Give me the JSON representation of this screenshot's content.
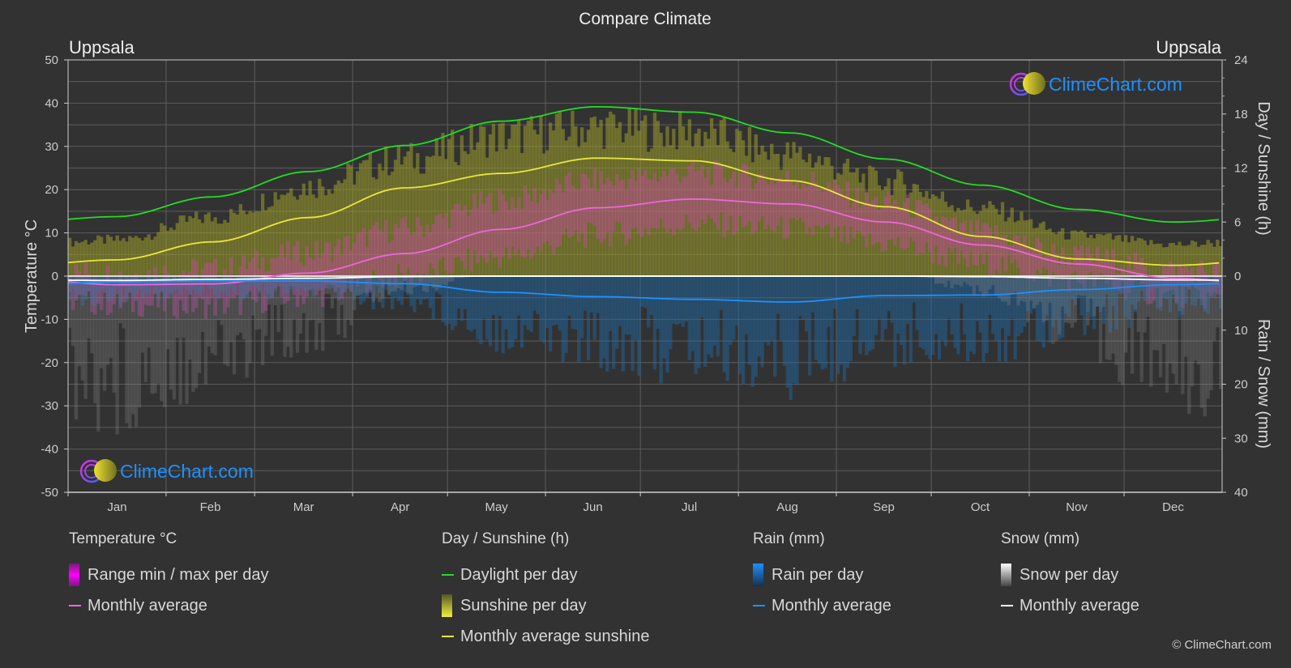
{
  "title": "Compare Climate",
  "location_left": "Uppsala",
  "location_right": "Uppsala",
  "watermark": "ClimeChart.com",
  "copyright": "© ClimeChart.com",
  "chart_data": {
    "type": "area",
    "title": "Compare Climate",
    "categories": [
      "Jan",
      "Feb",
      "Mar",
      "Apr",
      "May",
      "Jun",
      "Jul",
      "Aug",
      "Sep",
      "Oct",
      "Nov",
      "Dec"
    ],
    "left_axis": {
      "label": "Temperature °C",
      "range": [
        -50,
        50
      ],
      "ticks": [
        50,
        40,
        30,
        20,
        10,
        0,
        -10,
        -20,
        -30,
        -40,
        -50
      ]
    },
    "right_axis_top": {
      "label": "Day / Sunshine (h)",
      "range": [
        0,
        24
      ],
      "ticks": [
        24,
        18,
        12,
        6,
        0
      ]
    },
    "right_axis_bottom": {
      "label": "Rain / Snow (mm)",
      "range": [
        0,
        40
      ],
      "ticks": [
        0,
        10,
        20,
        30,
        40
      ]
    },
    "grid": true,
    "series": [
      {
        "name": "Daylight per day",
        "axis": "hours",
        "color": "#22dd22",
        "values": [
          6.6,
          8.8,
          11.6,
          14.5,
          17.2,
          18.8,
          18.2,
          15.9,
          13.0,
          10.1,
          7.4,
          6.0
        ]
      },
      {
        "name": "Monthly average sunshine",
        "axis": "hours",
        "color": "#e8e83a",
        "values": [
          1.8,
          3.8,
          6.5,
          9.8,
          11.4,
          13.1,
          12.8,
          10.6,
          7.7,
          4.4,
          1.9,
          1.2
        ]
      },
      {
        "name": "Temperature monthly average",
        "axis": "temperature",
        "color": "#ee66dd",
        "values": [
          -2.0,
          -1.8,
          0.7,
          5.2,
          10.8,
          15.8,
          17.8,
          16.7,
          12.5,
          7.2,
          2.8,
          -0.5
        ]
      },
      {
        "name": "Rain monthly average",
        "axis": "precip",
        "color": "#1e90ff",
        "values": [
          1.1,
          0.9,
          0.9,
          1.4,
          3.0,
          3.8,
          4.3,
          4.8,
          3.6,
          3.5,
          2.5,
          1.6
        ]
      },
      {
        "name": "Snow monthly average",
        "axis": "precip",
        "color": "#ffffff",
        "values": [
          0.8,
          0.6,
          0.4,
          0.1,
          0.0,
          0.0,
          0.0,
          0.0,
          0.0,
          0.1,
          0.4,
          0.7
        ]
      }
    ],
    "daily_ranges": {
      "temp_max_monthly": [
        0.5,
        1.5,
        5.5,
        11.0,
        17.5,
        22.0,
        24.0,
        22.5,
        17.0,
        10.0,
        4.5,
        1.5
      ],
      "temp_min_monthly": [
        -6.5,
        -7.0,
        -4.5,
        0.0,
        4.5,
        9.5,
        12.0,
        11.0,
        7.5,
        3.0,
        -1.0,
        -4.5
      ],
      "sunshine_max_monthly": [
        4.0,
        6.5,
        10.0,
        13.0,
        15.5,
        16.5,
        16.0,
        13.5,
        10.5,
        7.5,
        4.5,
        3.5
      ]
    }
  },
  "legend": {
    "temperature": {
      "title": "Temperature °C",
      "range_label": "Range min / max per day",
      "avg_label": "Monthly average"
    },
    "sunshine": {
      "title": "Day / Sunshine (h)",
      "daylight_label": "Daylight per day",
      "sunshine_label": "Sunshine per day",
      "avg_label": "Monthly average sunshine"
    },
    "rain": {
      "title": "Rain (mm)",
      "per_day_label": "Rain per day",
      "avg_label": "Monthly average"
    },
    "snow": {
      "title": "Snow (mm)",
      "per_day_label": "Snow per day",
      "avg_label": "Monthly average"
    }
  },
  "colors": {
    "background": "#323232",
    "grid": "#5a5a5a",
    "temp_range": "#e000e0",
    "sunshine": "#e8e83a",
    "daylight": "#22dd22",
    "rain": "#1e90ff",
    "snow": "#ffffff",
    "brand_blue": "#1e90ff"
  }
}
